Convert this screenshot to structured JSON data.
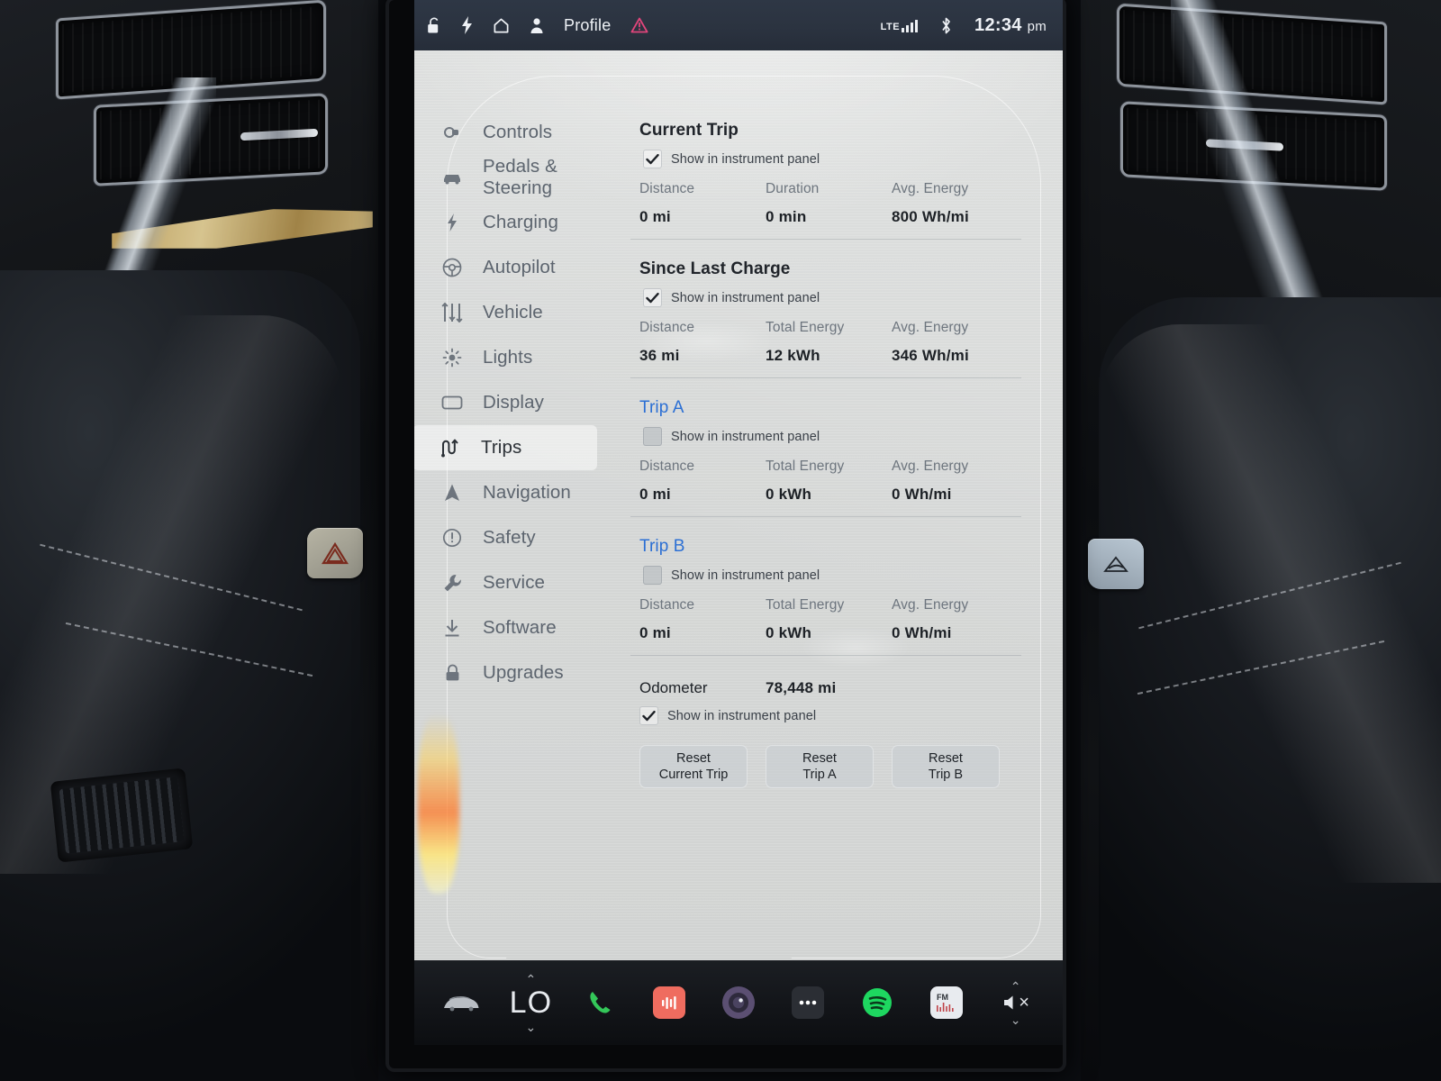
{
  "status_bar": {
    "lock_icon": "unlock-icon",
    "charge_icon": "bolt-icon",
    "home_icon": "home-icon",
    "person_icon": "person-icon",
    "profile_label": "Profile",
    "warning_icon": "warning-triangle-icon",
    "network_label": "LTE",
    "signal_icon": "signal-bars-icon",
    "bluetooth_icon": "bluetooth-icon",
    "time": "12:34",
    "meridiem": "pm"
  },
  "sidebar": {
    "items": [
      {
        "label": "Controls",
        "icon": "controls-icon",
        "active": false
      },
      {
        "label": "Pedals & Steering",
        "icon": "car-icon",
        "active": false
      },
      {
        "label": "Charging",
        "icon": "bolt-icon",
        "active": false
      },
      {
        "label": "Autopilot",
        "icon": "steering-icon",
        "active": false
      },
      {
        "label": "Vehicle",
        "icon": "sliders-icon",
        "active": false
      },
      {
        "label": "Lights",
        "icon": "sun-icon",
        "active": false
      },
      {
        "label": "Display",
        "icon": "display-icon",
        "active": false
      },
      {
        "label": "Trips",
        "icon": "trips-icon",
        "active": true
      },
      {
        "label": "Navigation",
        "icon": "navigation-icon",
        "active": false
      },
      {
        "label": "Safety",
        "icon": "alert-circle-icon",
        "active": false
      },
      {
        "label": "Service",
        "icon": "wrench-icon",
        "active": false
      },
      {
        "label": "Software",
        "icon": "download-icon",
        "active": false
      },
      {
        "label": "Upgrades",
        "icon": "lock-icon",
        "active": false
      }
    ]
  },
  "main": {
    "checkbox_label": "Show in instrument panel",
    "sections": [
      {
        "title": "Current Trip",
        "title_is_link": false,
        "checked": true,
        "columns": [
          {
            "head": "Distance",
            "value": "0",
            "unit": "mi"
          },
          {
            "head": "Duration",
            "value": "0",
            "unit": "min"
          },
          {
            "head": "Avg. Energy",
            "value": "800",
            "unit": "Wh/mi"
          }
        ]
      },
      {
        "title": "Since Last Charge",
        "title_is_link": false,
        "checked": true,
        "columns": [
          {
            "head": "Distance",
            "value": "36",
            "unit": "mi"
          },
          {
            "head": "Total Energy",
            "value": "12",
            "unit": "kWh"
          },
          {
            "head": "Avg. Energy",
            "value": "346",
            "unit": "Wh/mi"
          }
        ]
      },
      {
        "title": "Trip A",
        "title_is_link": true,
        "checked": false,
        "columns": [
          {
            "head": "Distance",
            "value": "0",
            "unit": "mi"
          },
          {
            "head": "Total Energy",
            "value": "0",
            "unit": "kWh"
          },
          {
            "head": "Avg. Energy",
            "value": "0",
            "unit": "Wh/mi"
          }
        ]
      },
      {
        "title": "Trip B",
        "title_is_link": true,
        "checked": false,
        "columns": [
          {
            "head": "Distance",
            "value": "0",
            "unit": "mi"
          },
          {
            "head": "Total Energy",
            "value": "0",
            "unit": "kWh"
          },
          {
            "head": "Avg. Energy",
            "value": "0",
            "unit": "Wh/mi"
          }
        ]
      }
    ],
    "odometer": {
      "label": "Odometer",
      "value": "78,448",
      "unit": "mi",
      "checked": true,
      "checkbox_label": "Show in instrument panel"
    },
    "buttons": [
      {
        "line1": "Reset",
        "line2": "Current Trip"
      },
      {
        "line1": "Reset",
        "line2": "Trip A"
      },
      {
        "line1": "Reset",
        "line2": "Trip B"
      }
    ]
  },
  "app_bar": {
    "car_icon": "car-icon",
    "temperature": "LO",
    "chevron_up": "⌃",
    "chevron_down": "⌄",
    "items": [
      {
        "icon": "phone-icon",
        "label": "Phone"
      },
      {
        "icon": "media-icon",
        "label": "Media"
      },
      {
        "icon": "camera-icon",
        "label": "Camera"
      },
      {
        "icon": "more-icon",
        "label": "More"
      },
      {
        "icon": "spotify-icon",
        "label": "Spotify"
      },
      {
        "icon": "fm-radio-icon",
        "label": "FM"
      }
    ],
    "volume_icon": "volume-mute-icon",
    "volume_mute_mark": "×"
  },
  "colors": {
    "screen_bg": "#d9dbda",
    "status_bar": "#2b3340",
    "link_blue": "#2b6fd4",
    "text_dark": "#1d2126",
    "text_muted": "#6d757e",
    "spotify_green": "#1ed760",
    "media_red": "#ef6c5f",
    "phone_green": "#34c759"
  },
  "cabin": {
    "hazard_button": "hazard-lights-button",
    "defog_button": "rear-defog-button"
  }
}
